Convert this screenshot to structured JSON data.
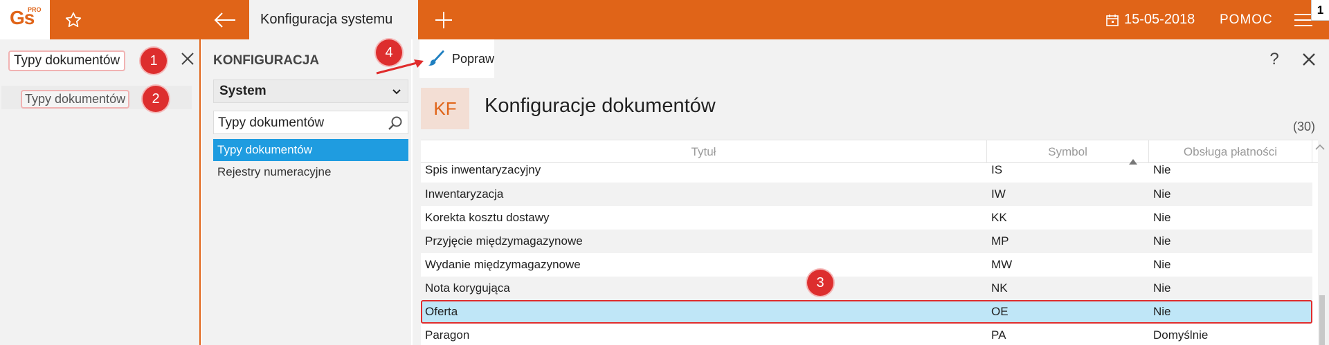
{
  "app": {
    "logo": "Gs",
    "logo_sub": "PRO",
    "active_tab": "Konfiguracja systemu",
    "date": "15-05-2018",
    "help": "POMOC",
    "badge": "1"
  },
  "search": {
    "value": "Typy dokumentów",
    "result": "Typy dokumentów"
  },
  "config": {
    "title": "KONFIGURACJA",
    "select_value": "System",
    "filter_value": "Typy dokumentów",
    "items": [
      {
        "label": "Typy dokumentów",
        "active": true
      },
      {
        "label": "Rejestry numeracyjne",
        "active": false
      }
    ]
  },
  "content": {
    "edit_button": "Popraw",
    "help_symbol": "?",
    "badge": "KF",
    "title": "Konfiguracje dokumentów",
    "count": "(30)",
    "columns": [
      "Tytuł",
      "Symbol",
      "Obsługa płatności"
    ],
    "rows": [
      {
        "title": "Spis inwentaryzacyjny",
        "symbol": "IS",
        "payment": "Nie"
      },
      {
        "title": "Inwentaryzacja",
        "symbol": "IW",
        "payment": "Nie"
      },
      {
        "title": "Korekta kosztu dostawy",
        "symbol": "KK",
        "payment": "Nie"
      },
      {
        "title": "Przyjęcie międzymagazynowe",
        "symbol": "MP",
        "payment": "Nie"
      },
      {
        "title": "Wydanie międzymagazynowe",
        "symbol": "MW",
        "payment": "Nie"
      },
      {
        "title": "Nota korygująca",
        "symbol": "NK",
        "payment": "Nie"
      },
      {
        "title": "Oferta",
        "symbol": "OE",
        "payment": "Nie"
      },
      {
        "title": "Paragon",
        "symbol": "PA",
        "payment": "Domyślnie"
      }
    ]
  },
  "callouts": [
    "1",
    "2",
    "3",
    "4"
  ],
  "colors": {
    "accent": "#e06418",
    "selection": "#1f9ce0",
    "selected_row": "#bfe6f7",
    "callout": "#dd2e2e"
  }
}
